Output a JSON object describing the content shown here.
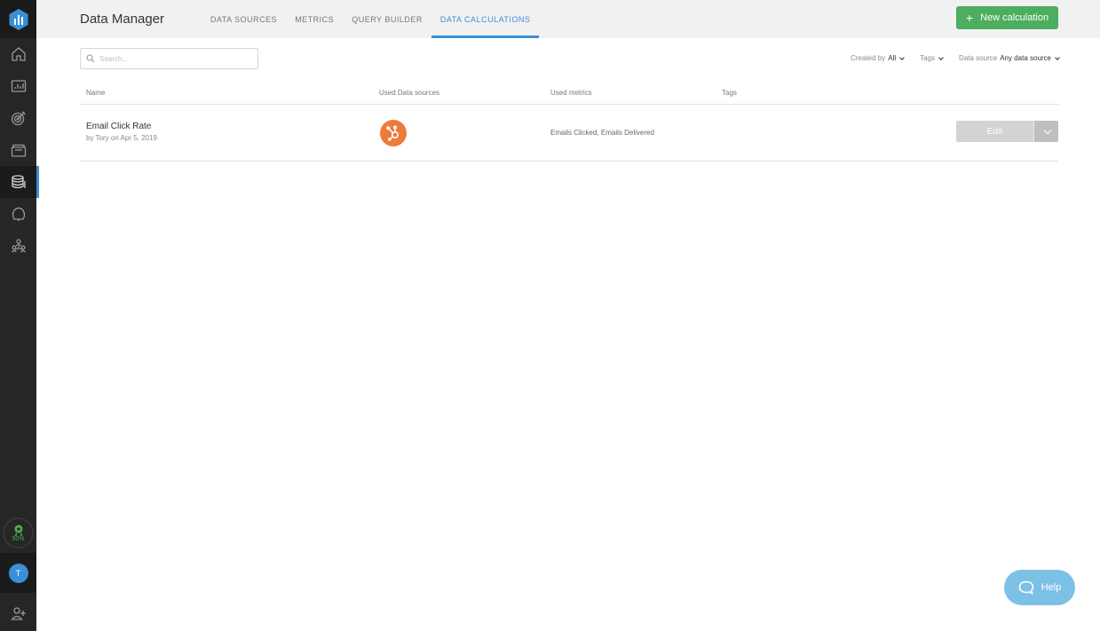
{
  "app": {
    "title": "Data Manager",
    "accent_color": "#3b8fd6",
    "primary_button_color": "#4cae5e"
  },
  "sidebar": {
    "items": [
      {
        "icon": "home-icon"
      },
      {
        "icon": "dashboard-icon"
      },
      {
        "icon": "goals-icon"
      },
      {
        "icon": "reports-icon"
      },
      {
        "icon": "data-manager-icon",
        "active": true
      },
      {
        "icon": "alerts-icon"
      },
      {
        "icon": "team-icon"
      }
    ],
    "goal_progress": "50%",
    "avatar_initial": "T"
  },
  "header": {
    "tabs": [
      {
        "label": "DATA SOURCES",
        "active": false
      },
      {
        "label": "METRICS",
        "active": false
      },
      {
        "label": "QUERY BUILDER",
        "active": false
      },
      {
        "label": "DATA CALCULATIONS",
        "active": true
      }
    ],
    "new_button_label": "New calculation"
  },
  "toolbar": {
    "search_placeholder": "Search...",
    "filters": {
      "created_by_label": "Created by",
      "created_by_value": "All",
      "tags_label": "Tags",
      "data_source_label": "Data source",
      "data_source_value": "Any data source"
    }
  },
  "table": {
    "columns": [
      "Name",
      "Used Data sources",
      "Used metrics",
      "Tags"
    ],
    "rows": [
      {
        "name": "Email Click Rate",
        "meta": "by Tory on Apr 5, 2019",
        "data_source_icon": "hubspot-icon",
        "metrics": "Emails Clicked, Emails Delivered",
        "tags": "",
        "edit_label": "Edit"
      }
    ]
  },
  "help": {
    "label": "Help"
  }
}
